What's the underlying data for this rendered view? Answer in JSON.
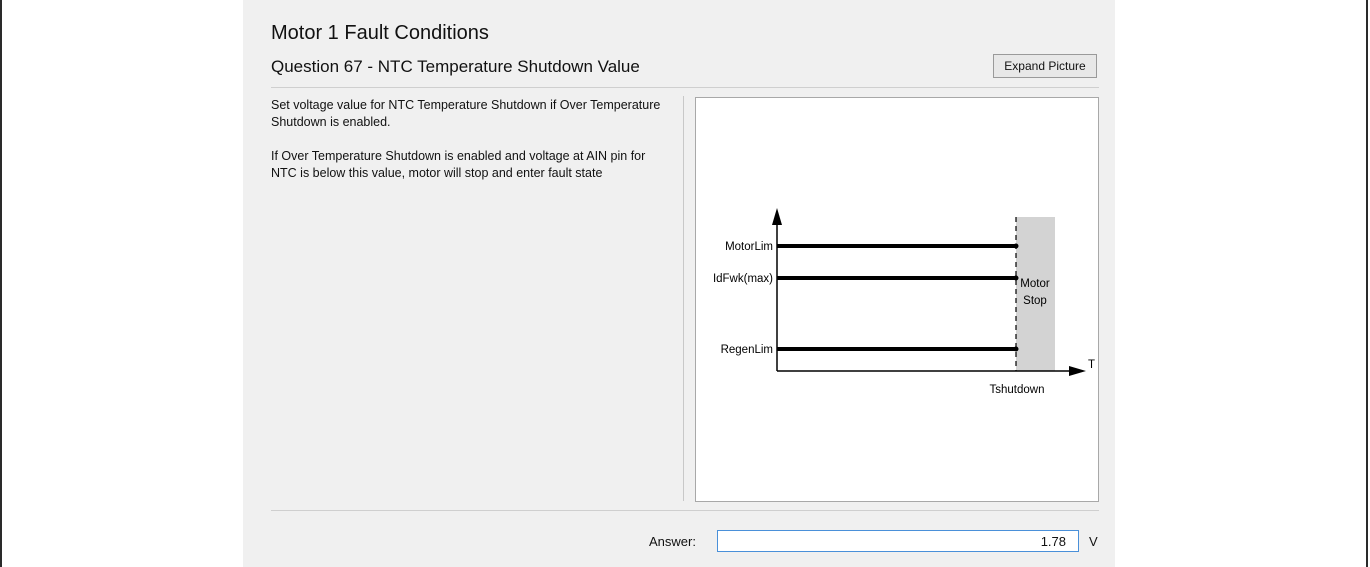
{
  "window": {
    "title": "Motor 1 Fault Conditions",
    "question": "Question 67 - NTC Temperature Shutdown Value",
    "expand_button": "Expand Picture"
  },
  "description": {
    "paragraph1": "Set voltage value for NTC Temperature Shutdown if Over Temperature Shutdown is enabled.",
    "paragraph2": "If Over Temperature Shutdown is enabled and voltage at AIN pin for NTC is below this value, motor will stop and enter fault state"
  },
  "diagram": {
    "labels": {
      "motor_lim": "MotorLim",
      "idfwk_max": "IdFwk(max)",
      "regen_lim": "RegenLim",
      "x_axis": "T",
      "t_shutdown": "Tshutdown",
      "motor_stop_line1": "Motor",
      "motor_stop_line2": "Stop"
    },
    "colors": {
      "line": "#000000",
      "shaded_region": "#d3d3d3"
    }
  },
  "answer": {
    "label": "Answer:",
    "value": "1.78",
    "unit": "V"
  }
}
